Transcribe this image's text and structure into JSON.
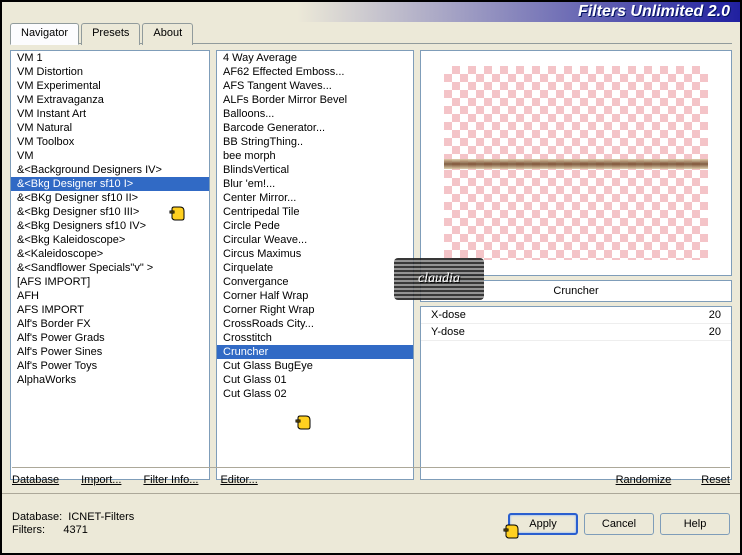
{
  "title": "Filters Unlimited 2.0",
  "tabs": {
    "navigator": "Navigator",
    "presets": "Presets",
    "about": "About"
  },
  "categories": [
    "VM 1",
    "VM Distortion",
    "VM Experimental",
    "VM Extravaganza",
    "VM Instant Art",
    "VM Natural",
    "VM Toolbox",
    "VM",
    "&<Background Designers IV>",
    "&<Bkg Designer sf10 I>",
    "&<BKg Designer sf10 II>",
    "&<Bkg Designer sf10 III>",
    "&<Bkg Designers sf10 IV>",
    "&<Bkg Kaleidoscope>",
    "&<Kaleidoscope>",
    "&<Sandflower Specials\"v\" >",
    "[AFS IMPORT]",
    "AFH",
    "AFS IMPORT",
    "Alf's Border FX",
    "Alf's Power Grads",
    "Alf's Power Sines",
    "Alf's Power Toys",
    "AlphaWorks"
  ],
  "category_selected": 9,
  "filters": [
    "4 Way Average",
    "AF62 Effected Emboss...",
    "AFS Tangent Waves...",
    "ALFs Border Mirror Bevel",
    "Balloons...",
    "Barcode Generator...",
    "BB StringThing..",
    "bee morph",
    "BlindsVertical",
    "Blur 'em!...",
    "Center Mirror...",
    "Centripedal Tile",
    "Circle Pede",
    "Circular Weave...",
    "Circus Maximus",
    "Cirquelate",
    "Convergance",
    "Corner Half Wrap",
    "Corner Right Wrap",
    "CrossRoads City...",
    "Crosstitch",
    "Cruncher",
    "Cut Glass  BugEye",
    "Cut Glass 01",
    "Cut Glass 02"
  ],
  "filter_selected": 21,
  "current_filter_name": "Cruncher",
  "params": [
    {
      "label": "X-dose",
      "value": "20"
    },
    {
      "label": "Y-dose",
      "value": "20"
    }
  ],
  "links": {
    "database": "Database",
    "import": "Import...",
    "filterinfo": "Filter Info...",
    "editor": "Editor...",
    "randomize": "Randomize",
    "reset": "Reset"
  },
  "footer": {
    "db_label": "Database:",
    "db_value": "ICNET-Filters",
    "filters_label": "Filters:",
    "filters_count": "4371"
  },
  "buttons": {
    "apply": "Apply",
    "cancel": "Cancel",
    "help": "Help"
  },
  "watermark": "claudia"
}
